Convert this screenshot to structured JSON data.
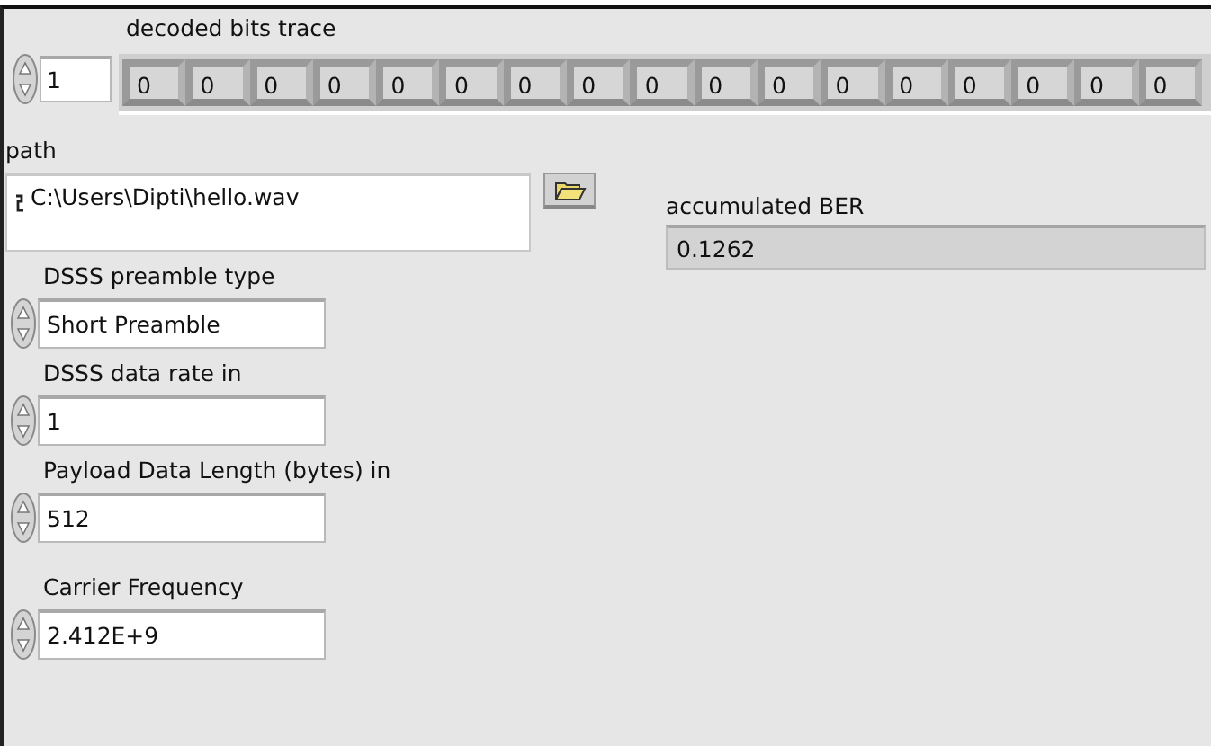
{
  "bits_trace": {
    "label": "decoded bits trace",
    "index": "1",
    "values": [
      "0",
      "0",
      "0",
      "0",
      "0",
      "0",
      "0",
      "0",
      "0",
      "0",
      "0",
      "0",
      "0",
      "0",
      "0",
      "0",
      "0"
    ]
  },
  "path": {
    "label": "path",
    "value": "C:\\Users\\Dipti\\hello.wav"
  },
  "accumulated_ber": {
    "label": "accumulated BER",
    "value": "0.1262"
  },
  "controls": [
    {
      "label": "DSSS preamble type",
      "value": "Short Preamble"
    },
    {
      "label": "DSSS data rate in",
      "value": "1"
    },
    {
      "label": "Payload Data Length (bytes) in",
      "value": "512"
    },
    {
      "label": "Carrier Frequency",
      "value": "2.412E+9"
    }
  ]
}
